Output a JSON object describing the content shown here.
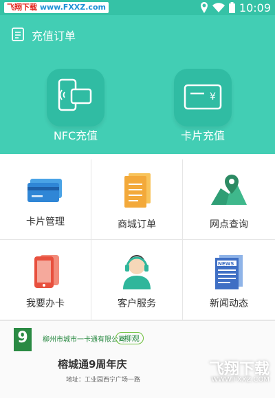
{
  "status_bar": {
    "watermark_left": "飞翔下载",
    "watermark_right": "www.FXXZ.com",
    "time": "10:09",
    "icons": [
      "location-icon",
      "wifi-icon",
      "battery-icon"
    ]
  },
  "header": {
    "title": "充值订单"
  },
  "primary_actions": [
    {
      "label": "NFC充值",
      "icon": "nfc-phone-icon"
    },
    {
      "label": "卡片充值",
      "icon": "card-yen-icon"
    }
  ],
  "grid": [
    {
      "label": "卡片管理",
      "icon": "cards-icon"
    },
    {
      "label": "商城订单",
      "icon": "document-icon"
    },
    {
      "label": "网点查询",
      "icon": "map-pin-icon"
    },
    {
      "label": "我要办卡",
      "icon": "phone-card-icon"
    },
    {
      "label": "客户服务",
      "icon": "headset-agent-icon"
    },
    {
      "label": "新闻动态",
      "icon": "newspaper-icon"
    }
  ],
  "banner": {
    "logo_number": "9",
    "org_name": "柳州市城市一卡通有限公司",
    "partner": "e柳观",
    "headline": "榕城通9周年庆",
    "address": "地址：工业园西宁广场一路",
    "watermark_logo": "飞翔下载",
    "watermark_url": "WWW.FXXZ.COM"
  },
  "colors": {
    "header_bg": "#42ceb4",
    "button_bg": "#30bca3",
    "text": "#333333"
  }
}
